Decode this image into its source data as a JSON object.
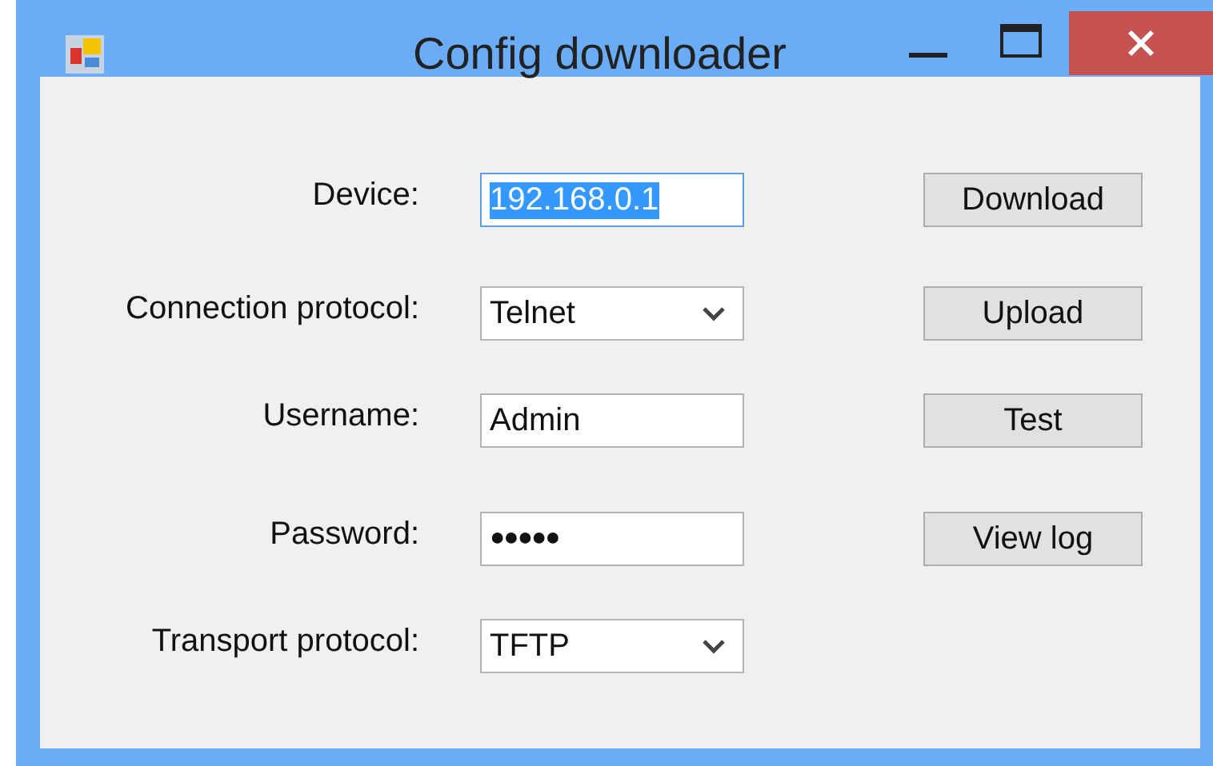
{
  "window": {
    "title": "Config downloader"
  },
  "fields": [
    {
      "label": "Device:",
      "kind": "text",
      "value": "192.168.0.1",
      "text_selected": true
    },
    {
      "label": "Connection protocol:",
      "kind": "select",
      "value": "Telnet",
      "text_selected": false
    },
    {
      "label": "Username:",
      "kind": "text",
      "value": "Admin",
      "text_selected": false
    },
    {
      "label": "Password:",
      "kind": "password",
      "value": "●●●●●",
      "text_selected": false
    },
    {
      "label": "Transport protocol:",
      "kind": "select",
      "value": "TFTP",
      "text_selected": false
    }
  ],
  "buttons": [
    "Download",
    "Upload",
    "Test",
    "View log"
  ]
}
